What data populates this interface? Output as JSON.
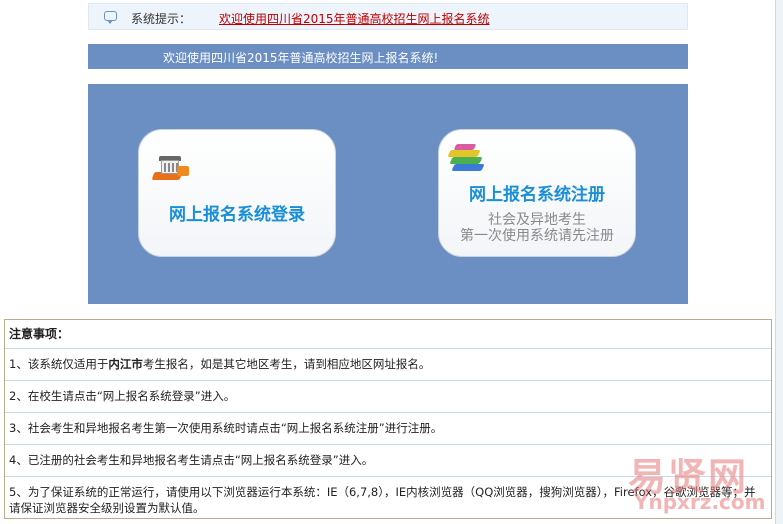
{
  "notice": {
    "label": "系统提示：",
    "link": "欢迎使用四川省2015年普通高校招生网上报名系统"
  },
  "welcome": "欢迎使用四川省2015年普通高校招生网上报名系统!",
  "cards": {
    "login": {
      "title": "网上报名系统登录"
    },
    "register": {
      "title": "网上报名系统注册",
      "sub1": "社会及异地考生",
      "sub2": "第一次使用系统请先注册"
    }
  },
  "notes": {
    "header": "注意事项：",
    "item1_pre": "1、该系统仅适用于",
    "item1_bold": "内江市",
    "item1_post": "考生报名，如是其它地区考生，请到相应地区网址报名。",
    "item2": "2、在校生请点击“网上报名系统登录”进入。",
    "item3": "3、社会考生和异地报名考生第一次使用系统时请点击“网上报名系统注册”进行注册。",
    "item4": "4、已注册的社会考生和异地报名考生请点击“网上报名系统登录”进入。",
    "item5": "5、为了保证系统的正常运行，请使用以下浏览器运行本系统：IE（6,7,8），IE内核浏览器（QQ浏览器，搜狗浏览器），Firefox，谷歌浏览器等；并请保证浏览器安全级别设置为默认值。"
  },
  "watermark": {
    "big": "易贤网",
    "small": "Ynpxrz.com"
  },
  "colors": {
    "accent": "#6b8ec3",
    "title_blue": "#1a8fd8",
    "link_red": "#c00000"
  }
}
